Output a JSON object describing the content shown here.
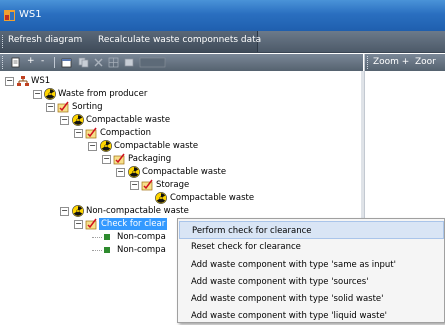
{
  "window": {
    "title": "WS1"
  },
  "toolbar": {
    "refresh_label": "Refresh diagram",
    "recalculate_label": "Recalculate waste componnets data"
  },
  "left_toolbar": {
    "plus_label": "+",
    "minus_label": "-"
  },
  "right_toolbar": {
    "zoom_in_label": "Zoom +",
    "zoom_out_label": "Zoor"
  },
  "tree": {
    "root": "WS1",
    "nodes": [
      "Waste from producer",
      "Sorting",
      "Compactable waste",
      "Compaction",
      "Compactable waste",
      "Packaging",
      "Compactable waste",
      "Storage",
      "Compactable waste",
      "Non-compactable waste",
      "Check for clear",
      "Non-compa",
      "Non-compa"
    ]
  },
  "context_menu": {
    "items": [
      "Perform check for clearance",
      "Reset check for clearance",
      "Add waste component with type 'same as input'",
      "Add waste component with type 'sources'",
      "Add waste component with type 'solid waste'",
      "Add waste component with type 'liquid waste'"
    ]
  }
}
